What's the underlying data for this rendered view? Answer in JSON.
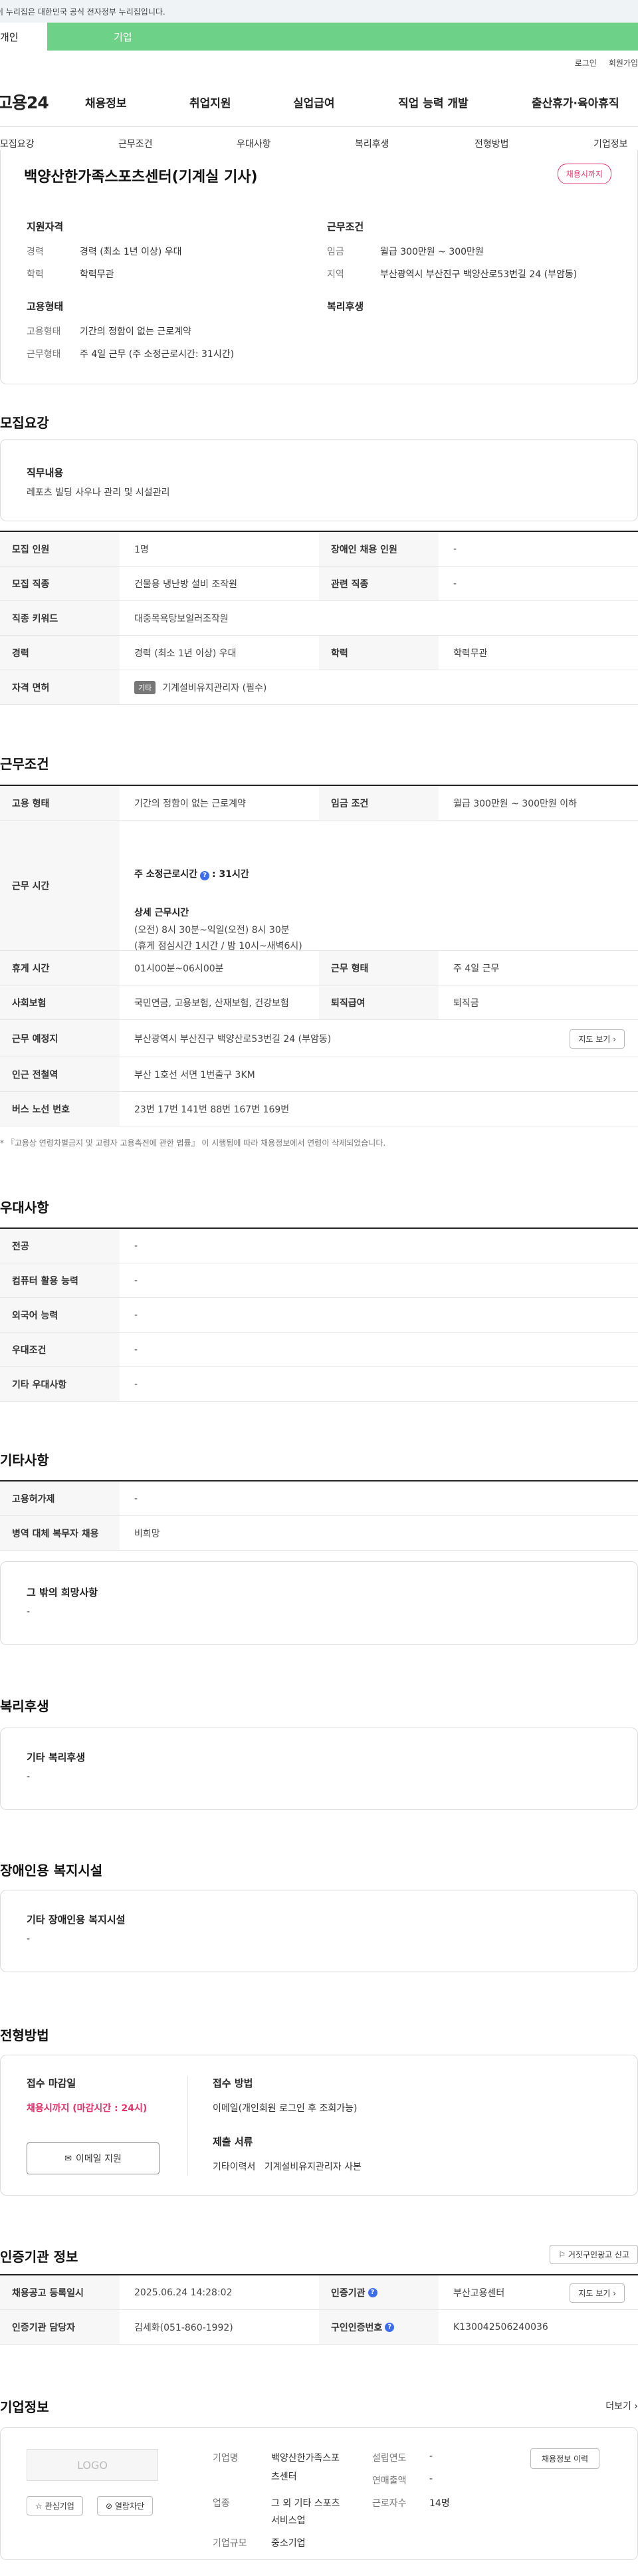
{
  "header": {
    "gov_notice": "이 누리집은 대한민국 공식 전자정부 누리집입니다.",
    "tab_individual": "개인",
    "tab_company": "기업",
    "login": "로그인",
    "signup": "회원가입",
    "logo": "고용24",
    "gnb": [
      "채용정보",
      "취업지원",
      "실업급여",
      "직업 능력 개발",
      "출산휴가·육아휴직"
    ]
  },
  "lnb": [
    "모집요강",
    "근무조건",
    "우대사항",
    "복리후생",
    "전형방법",
    "기업정보"
  ],
  "job": {
    "title": "백양산한가족스포츠센터(기계실 기사)",
    "badge": "채용시까지",
    "summary": {
      "qualification_h": "지원자격",
      "career_k": "경력",
      "career_v": "경력 (최소 1년 이상) 우대",
      "edu_k": "학력",
      "edu_v": "학력무관",
      "work_h": "근무조건",
      "wage_k": "임금",
      "wage_v": "월급 300만원 ~ 300만원",
      "area_k": "지역",
      "area_v": "부산광역시 부산진구 백양산로53번길 24 (부암동)",
      "employ_h": "고용형태",
      "type_k": "고용형태",
      "type_v": "기간의 정함이 없는 근로계약",
      "form_k": "근무형태",
      "form_v": "주 4일 근무 (주 소정근로시간: 31시간)",
      "welfare_h": "복리후생"
    }
  },
  "recruit": {
    "title": "모집요강",
    "duty_h": "직무내용",
    "duty_v": "레포츠 빌딩 사우나 관리 및 시설관리",
    "rows": [
      {
        "k1": "모집 인원",
        "v1": "1명",
        "k2": "장애인 채용 인원",
        "v2": "-"
      },
      {
        "k1": "모집 직종",
        "v1": "건물용 냉난방 설비 조작원",
        "k2": "관련 직종",
        "v2": "-"
      },
      {
        "k1": "직종 키워드",
        "v1": "대중목욕탕보일러조작원"
      },
      {
        "k1": "경력",
        "v1": "경력 (최소 1년 이상) 우대",
        "k2": "학력",
        "v2": "학력무관"
      },
      {
        "k1": "자격 면허",
        "tag": "기타",
        "v1": "기계설비유지관리자 (필수)"
      }
    ]
  },
  "conditions": {
    "title": "근무조건",
    "type_k": "고용 형태",
    "type_v": "기간의 정함이 없는 근로계약",
    "wage_k": "임금 조건",
    "wage_v": "월급 300만원 ~ 300만원 이하",
    "hours_k": "근무 시간",
    "hours_total": "주 소정근로시간",
    "hours_total_v": ": 31시간",
    "hours_detail_h": "상세 근무시간",
    "hours_detail_1": "(오전) 8시 30분~익일(오전) 8시 30분",
    "hours_detail_2": "(휴게 점심시간 1시간 / 밤 10시~새벽6시)",
    "rest_k": "휴게 시간",
    "rest_v": "01시00분~06시00분",
    "form_k": "근무 형태",
    "form_v": "주 4일 근무",
    "insurance_k": "사회보험",
    "insurance_v": "국민연금, 고용보험, 산재보험, 건강보험",
    "severance_k": "퇴직급여",
    "severance_v": "퇴직금",
    "place_k": "근무 예정지",
    "place_v": "부산광역시 부산진구 백양산로53번길 24 (부암동)",
    "map_button": "지도 보기",
    "subway_k": "인근 전철역",
    "subway_v": "부산 1호선 서면 1번출구 3KM",
    "bus_k": "버스 노선 번호",
    "bus_v": "23번 17번 141번 88번 167번 169번",
    "note": "* 『고용상 연령차별금지 및 고령자 고용촉진에 관한 법률』 이 시행됨에 따라 채용정보에서 연령이 삭제되었습니다."
  },
  "preference": {
    "title": "우대사항",
    "rows": [
      {
        "k": "전공",
        "v": "-"
      },
      {
        "k": "컴퓨터 활용 능력",
        "v": "-"
      },
      {
        "k": "외국어 능력",
        "v": "-"
      },
      {
        "k": "우대조건",
        "v": "-"
      },
      {
        "k": "기타 우대사항",
        "v": "-"
      }
    ]
  },
  "other": {
    "title": "기타사항",
    "rows": [
      {
        "k": "고용허가제",
        "v": "-"
      },
      {
        "k": "병역 대체 복무자 채용",
        "v": "비희망"
      }
    ],
    "extra_h": "그 밖의 희망사항",
    "extra_v": "-"
  },
  "welfare": {
    "title": "복리후생",
    "box_h": "기타 복리후생",
    "box_v": "-"
  },
  "disability": {
    "title": "장애인용 복지시설",
    "box_h": "기타 장애인용 복지시설",
    "box_v": "-"
  },
  "selection": {
    "title": "전형방법",
    "deadline_h": "접수 마감일",
    "deadline_v": "채용시까지 (마감시간 : 24시)",
    "email_button": "이메일 지원",
    "method_h": "접수 방법",
    "method_v": "이메일(개인회원 로그인 후 조회가능)",
    "docs_h": "제출 서류",
    "docs_v": "기타이력서   기계설비유지관리자 사본"
  },
  "certified": {
    "title": "인증기관 정보",
    "report_button": "거짓구인광고 신고",
    "rows": [
      {
        "k1": "채용공고 등록일시",
        "v1": "2025.06.24 14:28:02",
        "k2": "인증기관",
        "v2": "부산고용센터",
        "btn": "지도 보기"
      },
      {
        "k1": "인증기관 담당자",
        "v1": "김세화(051-860-1992)",
        "k2": "구인인증번호",
        "v2": "K130042506240036"
      }
    ]
  },
  "company": {
    "title": "기업정보",
    "more": "더보기",
    "logo": "LOGO",
    "interest_button": "관심기업",
    "block_button": "열람차단",
    "name_k": "기업명",
    "name_v1": "백양산한가족스포",
    "name_v2": "츠센터",
    "industry_k": "업종",
    "industry_v1": "그 외 기타 스포츠",
    "industry_v2": "서비스업",
    "size_k": "기업규모",
    "size_v": "중소기업",
    "founded_k": "설립연도",
    "founded_v": "-",
    "sales_k": "연매출액",
    "sales_v": "-",
    "employees_k": "근로자수",
    "employees_v": "14명",
    "history_button": "채용정보 이력"
  },
  "colors": {
    "accent_green": "#6dd187",
    "deadline_red": "#e9336a",
    "info_blue": "#3e6cf0"
  }
}
